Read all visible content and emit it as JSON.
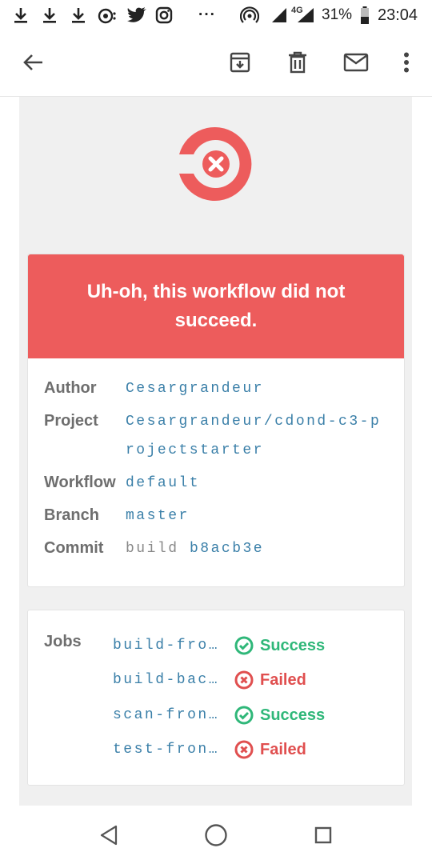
{
  "status_bar": {
    "battery": "31%",
    "time": "23:04",
    "network": "4G",
    "overflow": "···",
    "icons": [
      "download-icon",
      "download-icon",
      "download-icon",
      "podcast-icon",
      "twitter-icon",
      "instagram-icon",
      "hotspot-icon",
      "signal-icon",
      "battery-icon"
    ]
  },
  "app_bar": {
    "icons": [
      "back-arrow-icon",
      "archive-icon",
      "delete-icon",
      "mail-icon",
      "more-vert-icon"
    ]
  },
  "email": {
    "brand_color": "#ed5c5c",
    "banner_text": "Uh-oh, this workflow did not succeed.",
    "details": [
      {
        "label": "Author",
        "value": "Cesargrandeur"
      },
      {
        "label": "Project",
        "value": "Cesargrandeur/cdond-c3-projectstarter"
      },
      {
        "label": "Workflow",
        "value": "default"
      },
      {
        "label": "Branch",
        "value": "master"
      },
      {
        "label": "Commit",
        "value_prefix": "build",
        "value": "b8acb3e"
      }
    ],
    "jobs_label": "Jobs",
    "jobs": [
      {
        "name": "build-fro…",
        "status": "Success"
      },
      {
        "name": "build-bac…",
        "status": "Failed"
      },
      {
        "name": "scan-fron…",
        "status": "Success"
      },
      {
        "name": "test-fron…",
        "status": "Failed"
      }
    ],
    "colors": {
      "success": "#2fb779",
      "failed": "#e04f4f",
      "link": "#3a7fa8"
    }
  },
  "nav_bar": {
    "icons": [
      "nav-back-icon",
      "nav-home-icon",
      "nav-recents-icon"
    ]
  }
}
